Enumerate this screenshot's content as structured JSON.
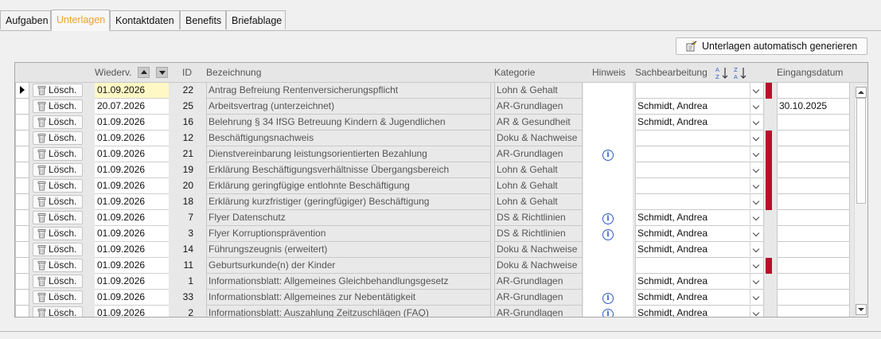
{
  "tabs": [
    {
      "label": "Aufgaben"
    },
    {
      "label": "Unterlagen"
    },
    {
      "label": "Kontaktdaten"
    },
    {
      "label": "Benefits"
    },
    {
      "label": "Briefablage"
    }
  ],
  "toolbar": {
    "generate_label": "Unterlagen automatisch generieren"
  },
  "columns": {
    "wiederv": "Wiederv.",
    "id": "ID",
    "bezeichnung": "Bezeichnung",
    "kategorie": "Kategorie",
    "hinweis": "Hinweis",
    "sachbearbeitung": "Sachbearbeitung",
    "eingangsdatum": "Eingangsdatum"
  },
  "delete_label": "Lösch.",
  "colors": {
    "accent_tab": "#f0a030",
    "flag_red": "#b8102a",
    "info_blue": "#2e5cc0"
  },
  "rows": [
    {
      "date": "01.09.2026",
      "id": "22",
      "bez": "Antrag Befreiung Rentenversicherungspflicht",
      "kat": "Lohn & Gehalt",
      "hint": false,
      "sach": "",
      "flag": true,
      "eing": ""
    },
    {
      "date": "20.07.2026",
      "id": "25",
      "bez": "Arbeitsvertrag (unterzeichnet)",
      "kat": "AR-Grundlagen",
      "hint": false,
      "sach": "Schmidt, Andrea",
      "flag": false,
      "eing": "30.10.2025"
    },
    {
      "date": "01.09.2026",
      "id": "16",
      "bez": "Belehrung § 34 IfSG Betreuung Kindern & Jugendlichen",
      "kat": "AR & Gesundheit",
      "hint": false,
      "sach": "Schmidt, Andrea",
      "flag": false,
      "eing": ""
    },
    {
      "date": "01.09.2026",
      "id": "12",
      "bez": "Beschäftigungsnachweis",
      "kat": "Doku & Nachweise",
      "hint": false,
      "sach": "",
      "flag": true,
      "eing": ""
    },
    {
      "date": "01.09.2026",
      "id": "21",
      "bez": "Dienstvereinbarung leistungsorientierten Bezahlung",
      "kat": "AR-Grundlagen",
      "hint": true,
      "sach": "",
      "flag": true,
      "eing": ""
    },
    {
      "date": "01.09.2026",
      "id": "19",
      "bez": "Erklärung Beschäftigungsverhältnisse Übergangsbereich",
      "kat": "Lohn & Gehalt",
      "hint": false,
      "sach": "",
      "flag": true,
      "eing": ""
    },
    {
      "date": "01.09.2026",
      "id": "20",
      "bez": "Erklärung geringfügige entlohnte Beschäftigung",
      "kat": "Lohn & Gehalt",
      "hint": false,
      "sach": "",
      "flag": true,
      "eing": ""
    },
    {
      "date": "01.09.2026",
      "id": "18",
      "bez": "Erklärung kurzfristiger (geringfügiger) Beschäftigung",
      "kat": "Lohn & Gehalt",
      "hint": false,
      "sach": "",
      "flag": true,
      "eing": ""
    },
    {
      "date": "01.09.2026",
      "id": "7",
      "bez": "Flyer Datenschutz",
      "kat": "DS & Richtlinien",
      "hint": true,
      "sach": "Schmidt, Andrea",
      "flag": false,
      "eing": ""
    },
    {
      "date": "01.09.2026",
      "id": "3",
      "bez": "Flyer Korruptionsprävention",
      "kat": "DS & Richtlinien",
      "hint": true,
      "sach": "Schmidt, Andrea",
      "flag": false,
      "eing": ""
    },
    {
      "date": "01.09.2026",
      "id": "14",
      "bez": "Führungszeugnis (erweitert)",
      "kat": "Doku & Nachweise",
      "hint": false,
      "sach": "Schmidt, Andrea",
      "flag": false,
      "eing": ""
    },
    {
      "date": "01.09.2026",
      "id": "11",
      "bez": "Geburtsurkunde(n) der Kinder",
      "kat": "Doku & Nachweise",
      "hint": false,
      "sach": "",
      "flag": true,
      "eing": ""
    },
    {
      "date": "01.09.2026",
      "id": "1",
      "bez": "Informationsblatt: Allgemeines Gleichbehandlungsgesetz",
      "kat": "AR-Grundlagen",
      "hint": false,
      "sach": "Schmidt, Andrea",
      "flag": false,
      "eing": ""
    },
    {
      "date": "01.09.2026",
      "id": "33",
      "bez": "Informationsblatt: Allgemeines zur Nebentätigkeit",
      "kat": "AR-Grundlagen",
      "hint": true,
      "sach": "Schmidt, Andrea",
      "flag": false,
      "eing": ""
    },
    {
      "date": "01.09.2026",
      "id": "2",
      "bez": "Informationsblatt: Auszahlung Zeitzuschlägen (FAQ)",
      "kat": "AR-Grundlagen",
      "hint": true,
      "sach": "Schmidt, Andrea",
      "flag": false,
      "eing": ""
    }
  ]
}
